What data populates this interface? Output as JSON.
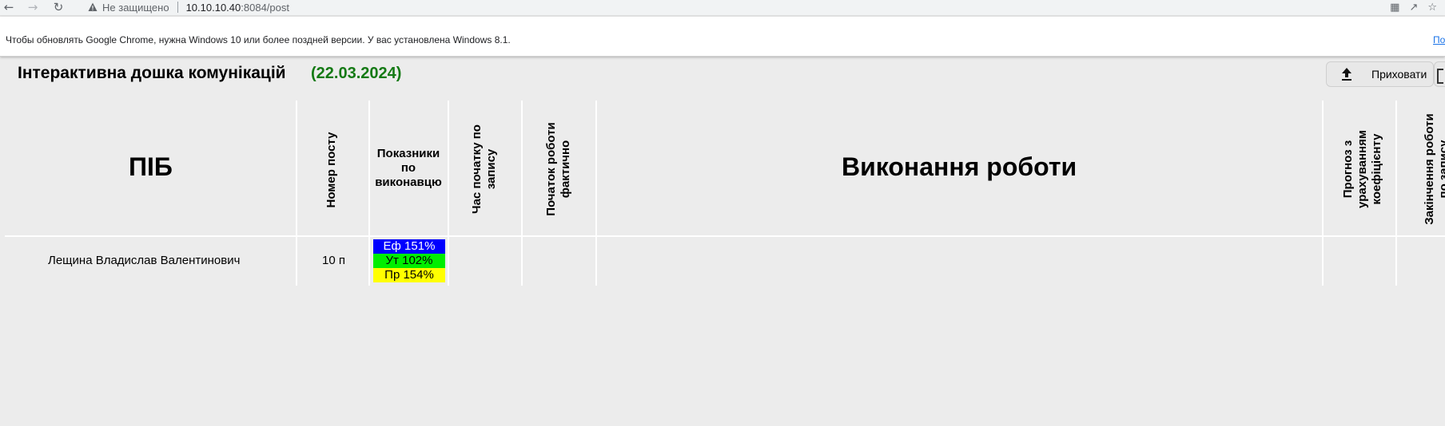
{
  "browser": {
    "security_label": "Не защищено",
    "url_host": "10.10.10.40",
    "url_rest": ":8084/post",
    "infobar_message": "Чтобы обновлять Google Chrome, нужна Windows 10 или более поздней версии. У вас установлена Windows 8.1.",
    "infobar_link": "По"
  },
  "page": {
    "title": "Інтерактивна дошка комунікацій",
    "date": "(22.03.2024)",
    "date_color": "#157a15",
    "hide_button_label": "Приховати"
  },
  "table": {
    "headers": {
      "name": "ПІБ",
      "post_number": "Номер посту",
      "indicators": [
        "Показники",
        "по",
        "виконавцю"
      ],
      "planned_start": [
        "Час початку по",
        "запису"
      ],
      "actual_start": [
        "Початок роботи",
        "фактично"
      ],
      "work_progress": "Виконання роботи",
      "forecast": [
        "Прогноз з",
        "урахуванням",
        "коефіцієнту"
      ],
      "planned_end": [
        "Закінчення роботи",
        "по запису"
      ]
    },
    "rows": [
      {
        "name": "Лещина Владислав Валентинович",
        "post": "10 п",
        "indicators": [
          {
            "label": "Еф 151%",
            "bg": "#0000ff",
            "fg": "#ffffff"
          },
          {
            "label": "Ут 102%",
            "bg": "#00ee00",
            "fg": "#000000"
          },
          {
            "label": "Пр 154%",
            "bg": "#ffff00",
            "fg": "#000000"
          }
        ]
      }
    ]
  }
}
